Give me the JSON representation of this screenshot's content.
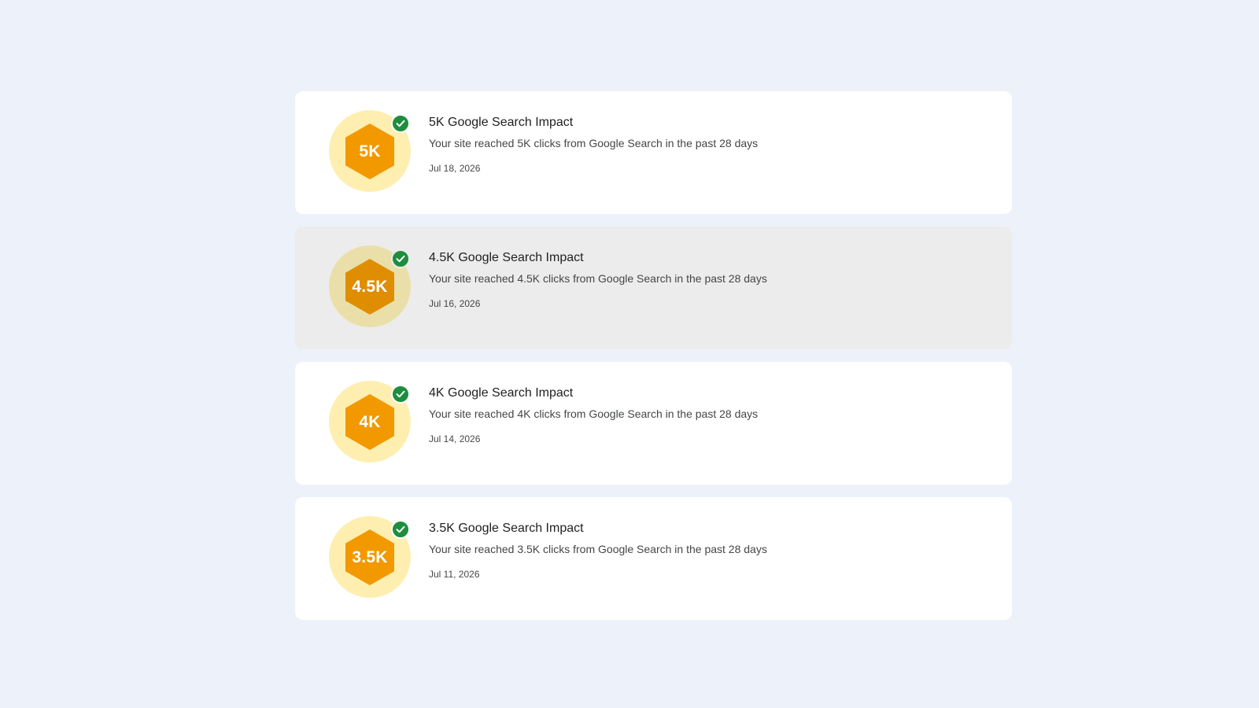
{
  "achievements": [
    {
      "badge": "5K",
      "title": "5K Google Search Impact",
      "description": "Your site reached 5K clicks from Google Search in the past 28 days",
      "date": "Jul 18, 2026",
      "icon": "hexagon-badge-icon",
      "status_icon": "check-circle-icon"
    },
    {
      "badge": "4.5K",
      "title": "4.5K Google Search Impact",
      "description": "Your site reached 4.5K clicks from Google Search in the past 28 days",
      "date": "Jul 16, 2026",
      "icon": "hexagon-badge-icon",
      "status_icon": "check-circle-icon",
      "hovered": true
    },
    {
      "badge": "4K",
      "title": "4K Google Search Impact",
      "description": "Your site reached 4K clicks from Google Search in the past 28 days",
      "date": "Jul 14, 2026",
      "icon": "hexagon-badge-icon",
      "status_icon": "check-circle-icon"
    },
    {
      "badge": "3.5K",
      "title": "3.5K Google Search Impact",
      "description": "Your site reached 3.5K clicks from Google Search in the past 28 days",
      "date": "Jul 11, 2026",
      "icon": "hexagon-badge-icon",
      "status_icon": "check-circle-icon"
    }
  ],
  "colors": {
    "page_background": "#edf2fa",
    "card_background": "#ffffff",
    "card_hover_background": "#ececec",
    "badge_ring": "#feefb1",
    "hexagon": "#f29900",
    "check": "#1e8e3e"
  }
}
